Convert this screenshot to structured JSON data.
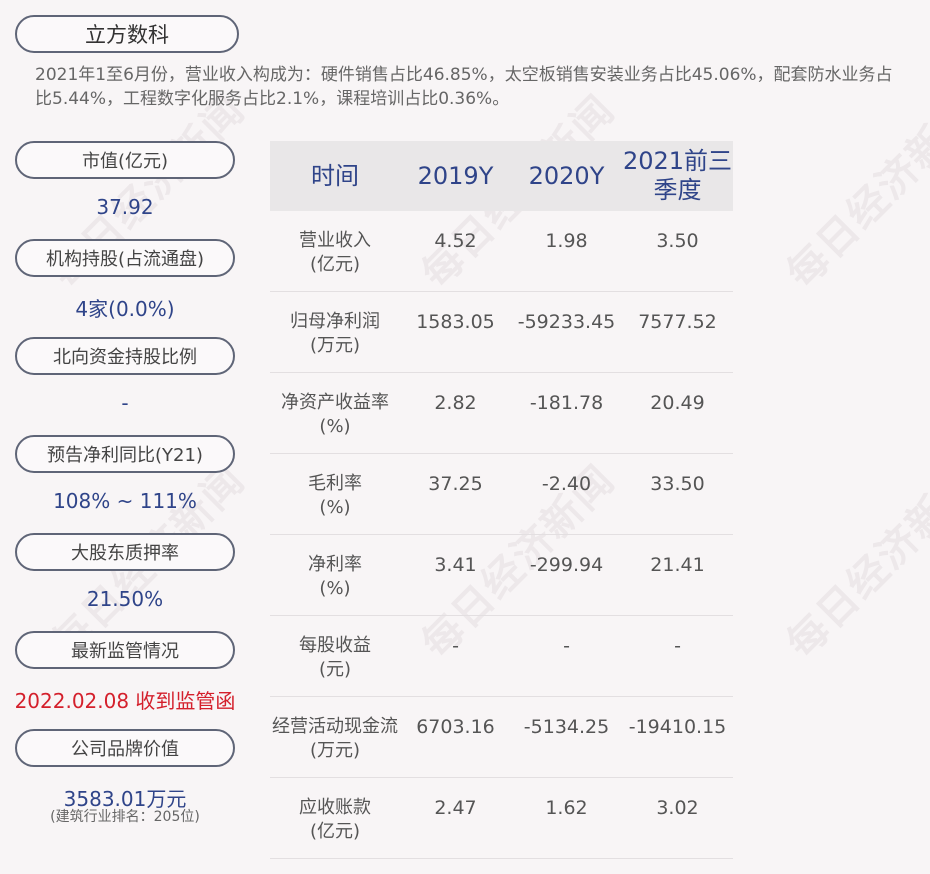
{
  "company_name": "立方数科",
  "intro_text": "2021年1至6月份，营业收入构成为：硬件销售占比46.85%，太空板销售安装业务占比45.06%，配套防水业务占比5.44%，工程数字化服务占比2.1%，课程培训占比0.36%。",
  "watermark": "每日经济新闻",
  "sidebar": [
    {
      "label": "市值(亿元)",
      "value": "37.92"
    },
    {
      "label": "机构持股(占流通盘)",
      "value": "4家(0.0%)"
    },
    {
      "label": "北向资金持股比例",
      "value": "-"
    },
    {
      "label": "预告净利同比(Y21)",
      "value": "108% ~ 111%"
    },
    {
      "label": "大股东质押率",
      "value": "21.50%"
    },
    {
      "label": "最新监管情况",
      "value": "2022.02.08 收到监管函"
    },
    {
      "label": "公司品牌价值",
      "value": "3583.01万元",
      "sub": "(建筑行业排名：205位)"
    }
  ],
  "table": {
    "headers": [
      "时间",
      "2019Y",
      "2020Y",
      "2021前三季度"
    ],
    "rows": [
      {
        "label": "营业收入",
        "unit": "(亿元)",
        "values": [
          "4.52",
          "1.98",
          "3.50"
        ]
      },
      {
        "label": "归母净利润",
        "unit": "(万元)",
        "values": [
          "1583.05",
          "-59233.45",
          "7577.52"
        ]
      },
      {
        "label": "净资产收益率",
        "unit": "(%)",
        "values": [
          "2.82",
          "-181.78",
          "20.49"
        ]
      },
      {
        "label": "毛利率",
        "unit": "(%)",
        "values": [
          "37.25",
          "-2.40",
          "33.50"
        ]
      },
      {
        "label": "净利率",
        "unit": "(%)",
        "values": [
          "3.41",
          "-299.94",
          "21.41"
        ]
      },
      {
        "label": "每股收益",
        "unit": "(元)",
        "values": [
          "-",
          "-",
          "-"
        ]
      },
      {
        "label": "经营活动现金流",
        "unit": "(万元)",
        "values": [
          "6703.16",
          "-5134.25",
          "-19410.15"
        ]
      },
      {
        "label": "应收账款",
        "unit": "(亿元)",
        "values": [
          "2.47",
          "1.62",
          "3.02"
        ]
      }
    ]
  },
  "colors": {
    "accent": "#2f4489",
    "alert": "#d4202c",
    "background": "#f8f5f6"
  }
}
